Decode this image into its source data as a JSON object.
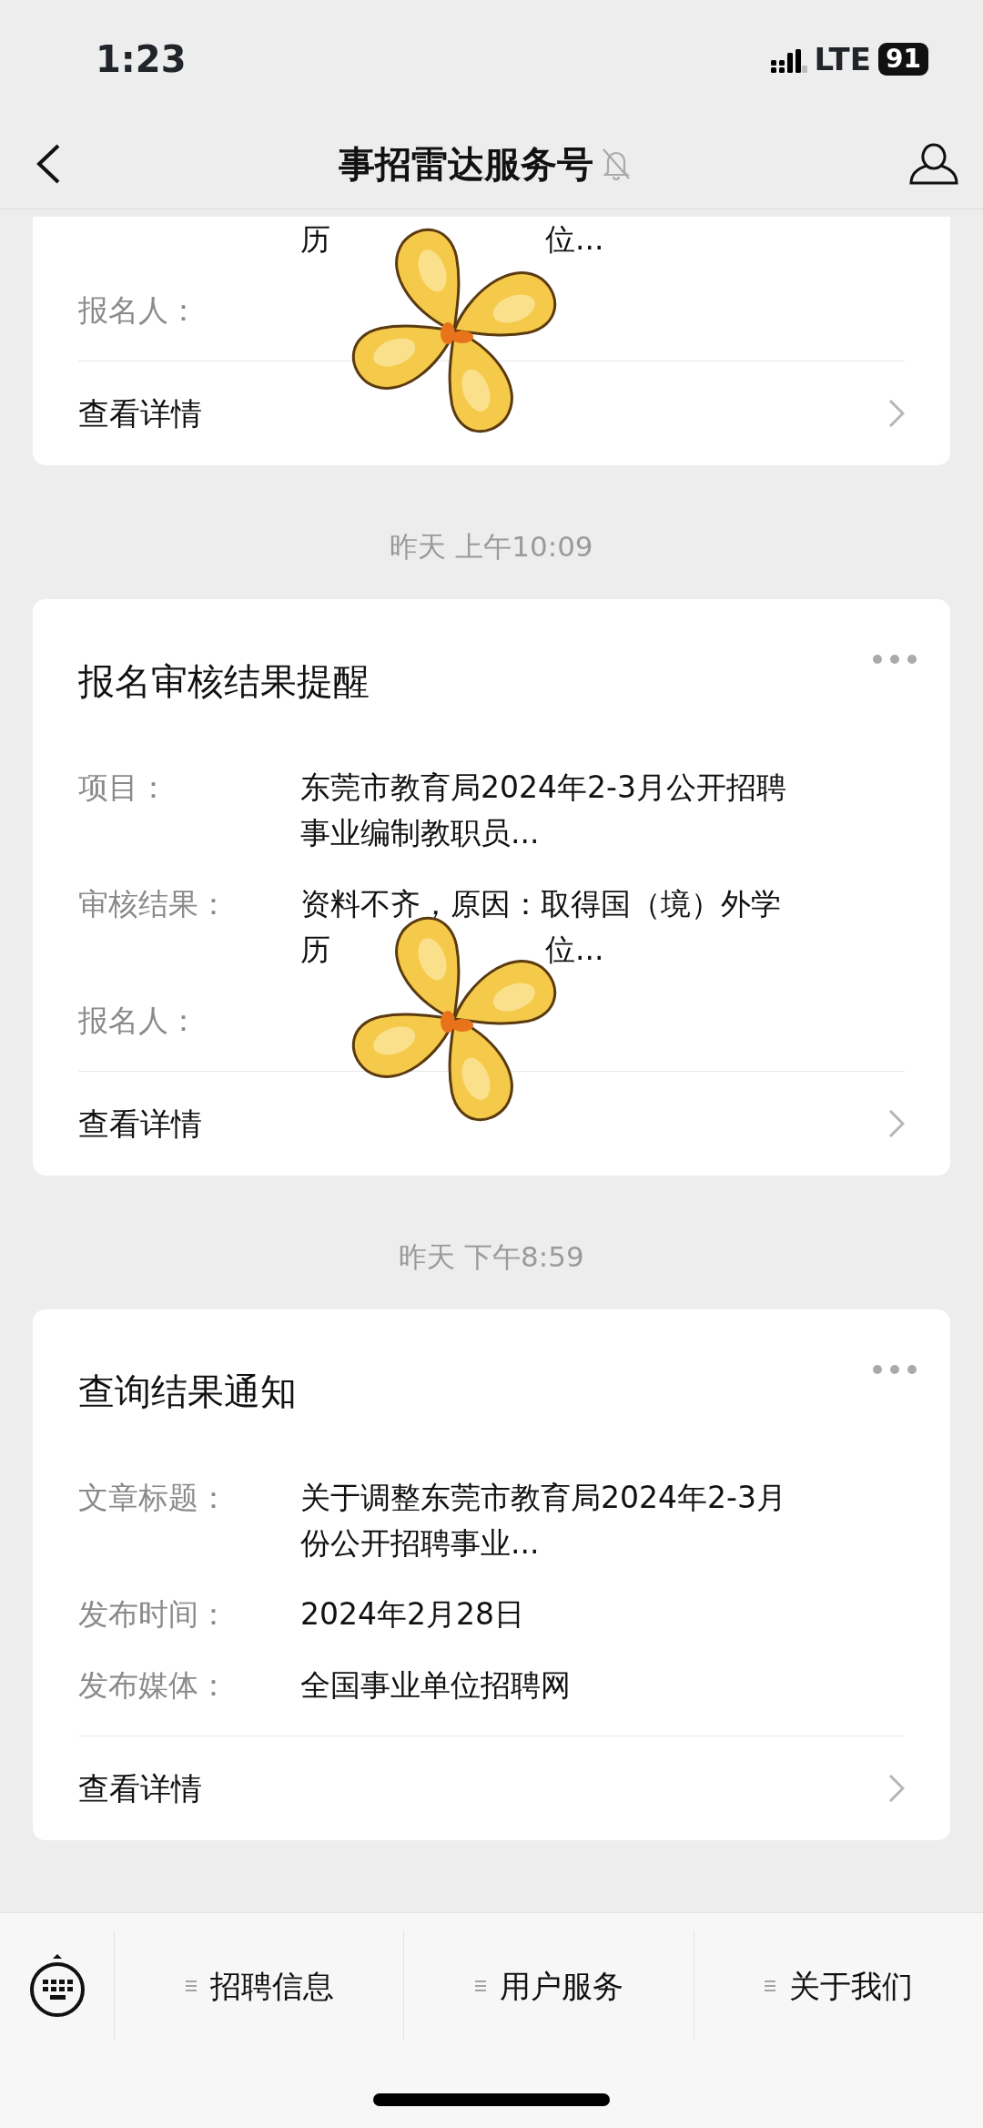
{
  "status_bar": {
    "time": "1:23",
    "network": "LTE",
    "battery": "91"
  },
  "header": {
    "title": "事招雷达服务号",
    "muted": true
  },
  "feed": [
    {
      "kind": "card",
      "sticker": true,
      "fields": [
        {
          "lines": [
            [
              "历",
              "位..."
            ]
          ]
        },
        {
          "label": "报名人："
        }
      ],
      "link": "查看详情"
    },
    {
      "kind": "timestamp",
      "text": "昨天 上午10:09"
    },
    {
      "kind": "card",
      "sticker": true,
      "title": "报名审核结果提醒",
      "fields": [
        {
          "label": "项目：",
          "lines": [
            [
              "东莞市教育局2024年2-3月公开招聘"
            ],
            [
              "事业编制教职员..."
            ]
          ]
        },
        {
          "label": "审核结果：",
          "lines": [
            [
              "资料不齐，原因：取得国（境）外学"
            ],
            [
              "历",
              "位..."
            ]
          ]
        },
        {
          "label": "报名人："
        }
      ],
      "link": "查看详情"
    },
    {
      "kind": "timestamp",
      "text": "昨天 下午8:59"
    },
    {
      "kind": "card",
      "sticker": false,
      "title": "查询结果通知",
      "fields": [
        {
          "label": "文章标题：",
          "lines": [
            [
              "关于调整东莞市教育局2024年2-3月"
            ],
            [
              "份公开招聘事业..."
            ]
          ]
        },
        {
          "label": "发布时间：",
          "lines": [
            [
              "2024年2月28日"
            ]
          ]
        },
        {
          "label": "发布媒体：",
          "lines": [
            [
              "全国事业单位招聘网"
            ]
          ]
        }
      ],
      "link": "查看详情"
    }
  ],
  "menu": [
    "招聘信息",
    "用户服务",
    "关于我们"
  ]
}
